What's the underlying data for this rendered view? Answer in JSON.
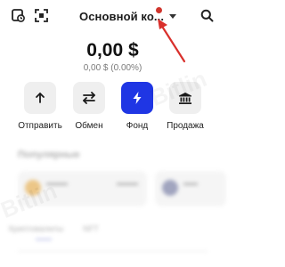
{
  "header": {
    "account_title": "Основной ко...",
    "icons": [
      "history-icon",
      "scan-icon",
      "search-icon"
    ]
  },
  "balance": {
    "amount": "0,00 $",
    "change": "0,00 $ (0.00%)"
  },
  "actions": [
    {
      "label": "Отправить",
      "icon": "arrow-up-icon"
    },
    {
      "label": "Обмен",
      "icon": "swap-icon"
    },
    {
      "label": "Фонд",
      "icon": "lightning-icon"
    },
    {
      "label": "Продажа",
      "icon": "bank-icon"
    }
  ],
  "colors": {
    "accent": "#1f36e4",
    "notification": "#d0352d",
    "annotation_arrow": "#d9302c"
  },
  "blurred": {
    "section_title": "Популярные",
    "tabs": [
      "Криптовалюты",
      "NFT"
    ]
  },
  "watermark": "Bitlin"
}
